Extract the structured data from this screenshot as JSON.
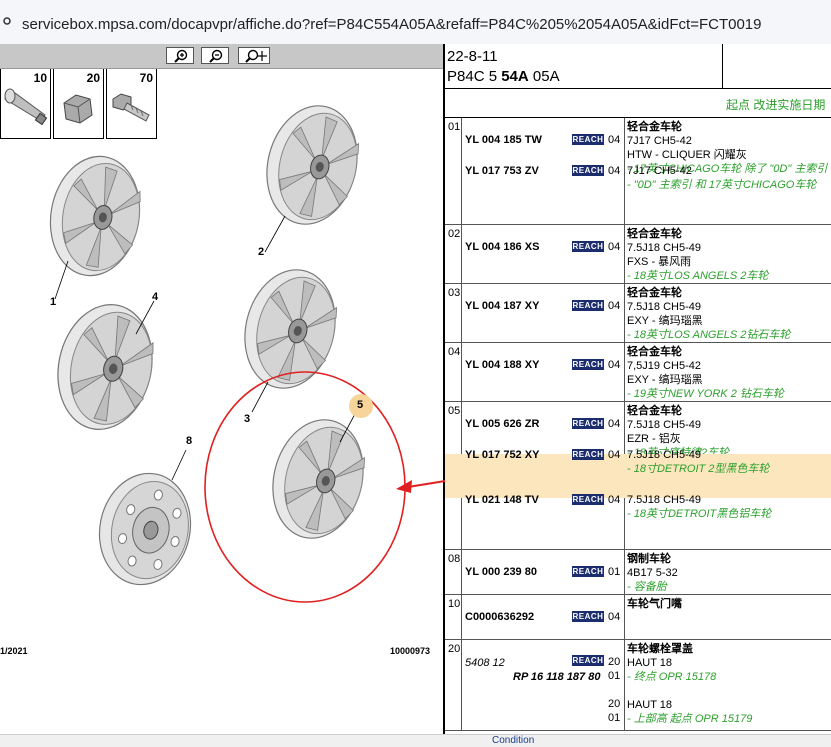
{
  "browser": {
    "url": "servicebox.mpsa.com/docapvpr/affiche.do?ref=P84C554A05A&refaff=P84C%205%2054A05A&idFct=FCT0019"
  },
  "zoom": {
    "zoom_in_icon": "zoom-in-icon",
    "zoom_out_icon": "zoom-out-icon",
    "zoom_move_icon": "zoom-pan-icon"
  },
  "illustration": {
    "fasteners": [
      {
        "num": "10",
        "icon": "valve-icon"
      },
      {
        "num": "20",
        "icon": "nut-icon"
      },
      {
        "num": "70",
        "icon": "bolt-icon"
      }
    ],
    "callouts": [
      "1",
      "2",
      "3",
      "4",
      "5",
      "8"
    ],
    "footer_left": "1/2021",
    "footer_right": "10000973",
    "colors": {
      "highlight_circle": "#e02020",
      "arrow": "#e02020",
      "callout5_bg": "#f7d49a"
    }
  },
  "header": {
    "date": "22-8-11",
    "code_prefix": "P84C 5 ",
    "code_bold": "54A",
    "code_suffix": " 05A",
    "implementation_label": "起点 改进实施日期"
  },
  "parts": [
    {
      "group": "01",
      "items": [
        {
          "ref": "YL 004 185 TW",
          "badge": "REACH",
          "qty": "04",
          "lines": [
            {
              "style": "t",
              "text": "轻合金车轮"
            },
            {
              "style": "n",
              "text": "7J17 CH5-42"
            },
            {
              "style": "n",
              "text": "HTW - CLIQUER 闪耀灰"
            },
            {
              "style": "g",
              "text": "- 17英寸CHICAGO车轮 除了 \"0D\" 主索引"
            }
          ]
        },
        {
          "ref": "YL 017 753 ZV",
          "badge": "REACH",
          "qty": "04",
          "lines": [
            {
              "style": "n",
              "text": "7J17 CH5-42"
            },
            {
              "style": "g",
              "text": "- \"0D\" 主索引 和 17英寸CHICAGO车轮"
            }
          ]
        }
      ]
    },
    {
      "group": "02",
      "items": [
        {
          "ref": "YL 004 186 XS",
          "badge": "REACH",
          "qty": "04",
          "lines": [
            {
              "style": "t",
              "text": "轻合金车轮"
            },
            {
              "style": "n",
              "text": "7.5J18 CH5-49"
            },
            {
              "style": "n",
              "text": "FXS - 暴风雨"
            },
            {
              "style": "g",
              "text": "- 18英寸LOS ANGELS 2车轮"
            }
          ]
        }
      ]
    },
    {
      "group": "03",
      "items": [
        {
          "ref": "YL 004 187 XY",
          "badge": "REACH",
          "qty": "04",
          "lines": [
            {
              "style": "t",
              "text": "轻合金车轮"
            },
            {
              "style": "n",
              "text": "7.5J18 CH5-49"
            },
            {
              "style": "n",
              "text": "EXY - 缟玛瑙黑"
            },
            {
              "style": "g",
              "text": "- 18英寸LOS ANGELS 2钻石车轮"
            }
          ]
        }
      ]
    },
    {
      "group": "04",
      "items": [
        {
          "ref": "YL 004 188 XY",
          "badge": "REACH",
          "qty": "04",
          "lines": [
            {
              "style": "t",
              "text": "轻合金车轮"
            },
            {
              "style": "n",
              "text": "7,5J19 CH5-42"
            },
            {
              "style": "n",
              "text": "EXY - 缟玛瑙黑"
            },
            {
              "style": "g",
              "text": "- 19英寸NEW YORK 2 钻石车轮"
            }
          ]
        }
      ]
    },
    {
      "group": "05",
      "items": [
        {
          "ref": "YL 005 626 ZR",
          "badge": "REACH",
          "qty": "04",
          "lines": [
            {
              "style": "t",
              "text": "轻合金车轮"
            },
            {
              "style": "n",
              "text": "7.5J18 CH5-49"
            },
            {
              "style": "n",
              "text": "EZR - 铝灰"
            },
            {
              "style": "g",
              "text": "- 18英寸底特律2车轮"
            }
          ]
        },
        {
          "ref": "YL 017 752 XY",
          "badge": "REACH",
          "qty": "04",
          "highlight": true,
          "lines": [
            {
              "style": "n",
              "text": "7.5J18 CH5-49"
            },
            {
              "style": "g",
              "text": "- 18寸DETROIT 2型黑色车轮"
            }
          ]
        },
        {
          "ref": "YL 021 148 TV",
          "badge": "REACH",
          "qty": "04",
          "lines": [
            {
              "style": "n",
              "text": "7.5J18 CH5-49"
            },
            {
              "style": "g",
              "text": "- 18英寸DETROIT黑色铝车轮"
            }
          ]
        }
      ]
    },
    {
      "group": "08",
      "items": [
        {
          "ref": "YL 000 239 80",
          "badge": "REACH",
          "qty": "01",
          "lines": [
            {
              "style": "t",
              "text": "钢制车轮"
            },
            {
              "style": "n",
              "text": "4B17 5-32"
            },
            {
              "style": "g",
              "text": "- 容备胎"
            }
          ]
        }
      ]
    },
    {
      "group": "10",
      "items": [
        {
          "ref": "C0000636292",
          "badge": "REACH",
          "qty": "04",
          "lines": [
            {
              "style": "t",
              "text": "车轮气门嘴"
            }
          ]
        }
      ]
    },
    {
      "group": "20",
      "items": [
        {
          "ref": "5408 12",
          "ref2": "RP 16 118 187 80",
          "badge": "REACH",
          "qty": "20",
          "qty2": "01",
          "lines": [
            {
              "style": "t",
              "text": "车轮螺栓罩盖"
            },
            {
              "style": "n",
              "text": "HAUT 18"
            },
            {
              "style": "g",
              "text": "- 终点 OPR 15178"
            },
            {
              "style": "n",
              "text": ""
            },
            {
              "style": "n",
              "text": "HAUT 18"
            },
            {
              "style": "g",
              "text": "- 上部高 起点 OPR 15179"
            }
          ],
          "qty3": "20",
          "qty4": "01"
        }
      ]
    }
  ],
  "bottom": {
    "condition": "Condition"
  }
}
